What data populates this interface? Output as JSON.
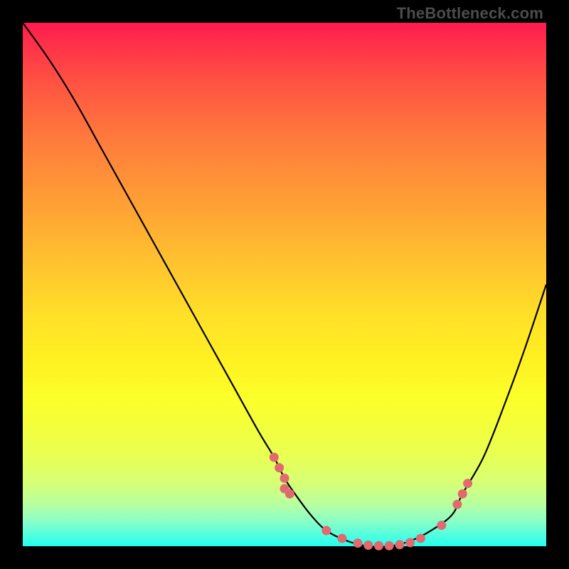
{
  "watermark": "TheBottleneck.com",
  "colors": {
    "background": "#000000",
    "curve": "#000000",
    "dot": "#e06a6f"
  },
  "chart_data": {
    "type": "line",
    "title": "",
    "xlabel": "",
    "ylabel": "",
    "xlim": [
      0,
      100
    ],
    "ylim": [
      0,
      100
    ],
    "grid": false,
    "series": [
      {
        "name": "bottleneck-curve",
        "x": [
          0,
          5,
          10,
          15,
          20,
          25,
          30,
          35,
          40,
          45,
          48,
          50,
          52,
          55,
          58,
          62,
          66,
          70,
          74,
          78,
          82,
          84,
          88,
          92,
          96,
          100
        ],
        "y": [
          100,
          93,
          85,
          76,
          67,
          58,
          49,
          40,
          31,
          22,
          17,
          13,
          10,
          6,
          3,
          1,
          0,
          0,
          1,
          3,
          6,
          10,
          17,
          27,
          38,
          50
        ]
      }
    ],
    "scatter": [
      {
        "name": "highlight-points",
        "x": [
          48,
          49,
          50,
          50,
          51,
          58,
          61,
          64,
          66,
          68,
          70,
          72,
          74,
          76,
          80,
          83,
          84,
          85
        ],
        "y": [
          17,
          15,
          13,
          11,
          10,
          3,
          1.5,
          0.6,
          0.2,
          0.1,
          0.1,
          0.3,
          0.7,
          1.5,
          4,
          8,
          10,
          12
        ]
      }
    ]
  }
}
